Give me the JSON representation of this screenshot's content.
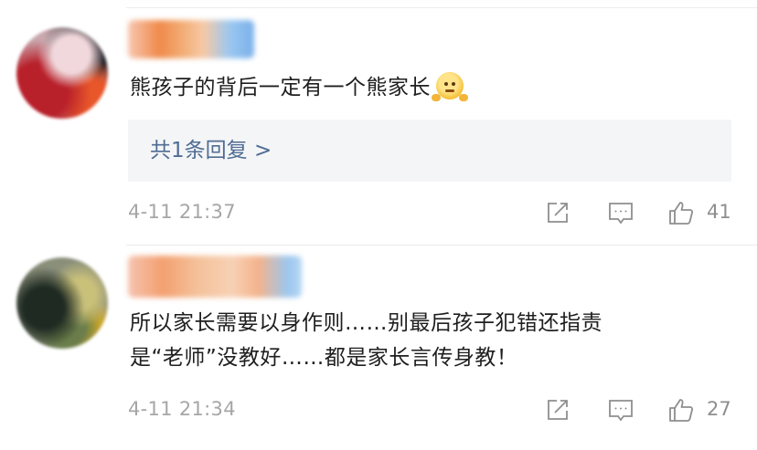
{
  "comments": [
    {
      "text": "熊孩子的背后一定有一个熊家长",
      "emoji": "shrug-emoji",
      "reply_link": "共1条回复 >",
      "timestamp": "4-11 21:37",
      "like_count": "41"
    },
    {
      "text_line1": "所以家长需要以身作则……别最后孩子犯错还指责",
      "text_line2": "是“老师”没教好……都是家长言传身教！",
      "timestamp": "4-11 21:34",
      "like_count": "27"
    }
  ],
  "colors": {
    "reply_link": "#4f6d93",
    "reply_box_bg": "#f4f5f7",
    "meta_text": "#a6a6a6",
    "icon_stroke": "#8e8e8e"
  },
  "icons": [
    "share-icon",
    "comment-icon",
    "thumbs-up-icon"
  ]
}
